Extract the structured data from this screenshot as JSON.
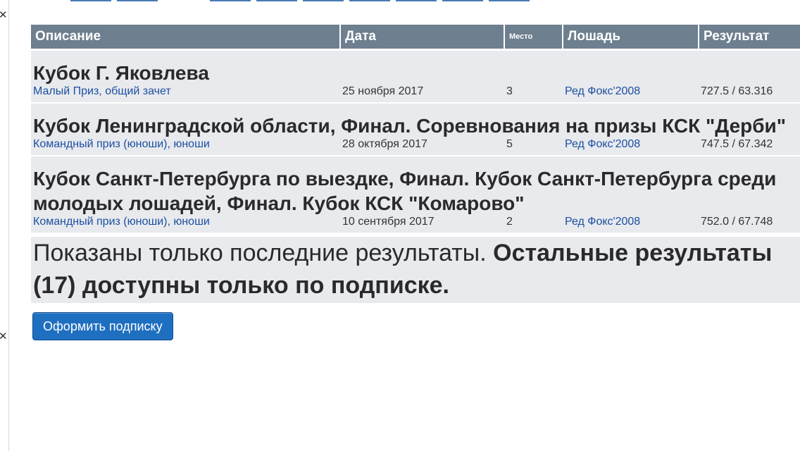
{
  "table": {
    "headers": {
      "description": "Описание",
      "date": "Дата",
      "place": "Место",
      "horse": "Лошадь",
      "result": "Результат"
    },
    "events": [
      {
        "title": "Кубок Г. Яковлева",
        "description": "Малый Приз, общий зачет",
        "date": "25 ноября 2017",
        "place": "3",
        "horse": "Ред Фокс'2008",
        "result": "727.5 / 63.316"
      },
      {
        "title": "Кубок Ленинградской области, Финал. Соревнования на призы КСК \"Дерби\"",
        "description": "Командный приз (юноши), юноши",
        "date": "28 октября 2017",
        "place": "5",
        "horse": "Ред Фокс'2008",
        "result": "747.5 / 67.342"
      },
      {
        "title": "Кубок Санкт-Петербурга по выездке, Финал. Кубок Санкт-Петербурга среди молодых лошадей, Финал. Кубок КСК \"Комарово\"",
        "description": "Командный приз (юноши), юноши",
        "date": "10 сентября 2017",
        "place": "2",
        "horse": "Ред Фокс'2008",
        "result": "752.0 / 67.748"
      }
    ]
  },
  "notice": {
    "text": "Показаны только последние результаты. ",
    "bold": "Остальные результаты (17) доступны только по подписке."
  },
  "subscribe_label": "Оформить подписку",
  "icons": {
    "close": "close-icon"
  },
  "colors": {
    "header_bg": "#6e7f8f",
    "row_bg": "#e8eaee",
    "link": "#1c4fa0",
    "button": "#1f6fc0"
  }
}
